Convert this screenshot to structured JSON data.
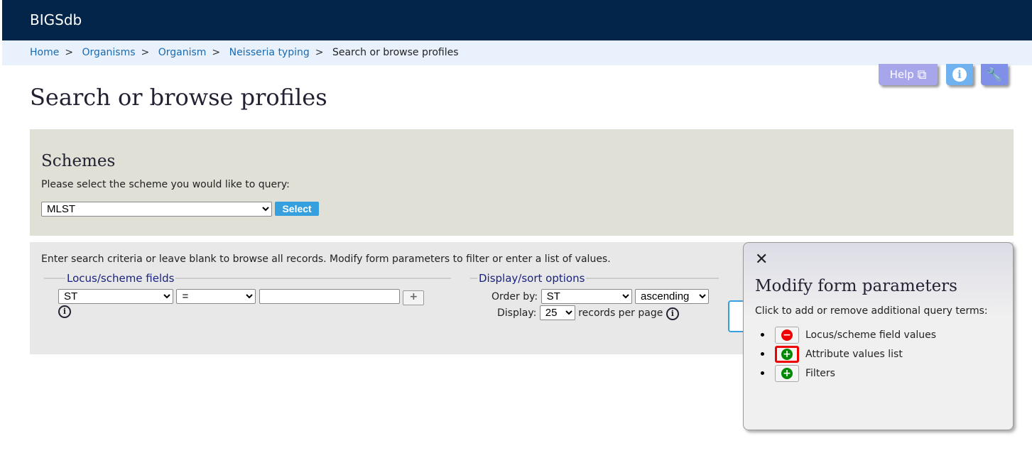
{
  "app": {
    "title": "BIGSdb"
  },
  "breadcrumb": [
    {
      "label": "Home"
    },
    {
      "label": "Organisms"
    },
    {
      "label": "Organism"
    },
    {
      "label": "Neisseria typing"
    },
    {
      "label": "Search or browse profiles"
    }
  ],
  "toolbar": {
    "help_label": "Help",
    "colors": {
      "help": "#a8a6ea",
      "info": "#70b2f0",
      "tools": "#8090e8"
    }
  },
  "page_title": "Search or browse profiles",
  "schemes": {
    "heading": "Schemes",
    "prompt": "Please select the scheme you would like to query:",
    "selected": "MLST",
    "select_button": "Select"
  },
  "search": {
    "intro": "Enter search criteria or leave blank to browse all records. Modify form parameters to filter or enter a list of values.",
    "locus_legend": "Locus/scheme fields",
    "field": "ST",
    "operator": "=",
    "value": "",
    "display_legend": "Display/sort options",
    "order_by_label": "Order by:",
    "order_by": "ST",
    "order": "ascending",
    "display_label": "Display:",
    "display": "25",
    "records_label": "records per page"
  },
  "modify_panel": {
    "title": "Modify form parameters",
    "instruction": "Click to add or remove additional query terms:",
    "items": [
      {
        "label": "Locus/scheme field values",
        "action": "remove"
      },
      {
        "label": "Attribute values list",
        "action": "add"
      },
      {
        "label": "Filters",
        "action": "add"
      }
    ]
  }
}
